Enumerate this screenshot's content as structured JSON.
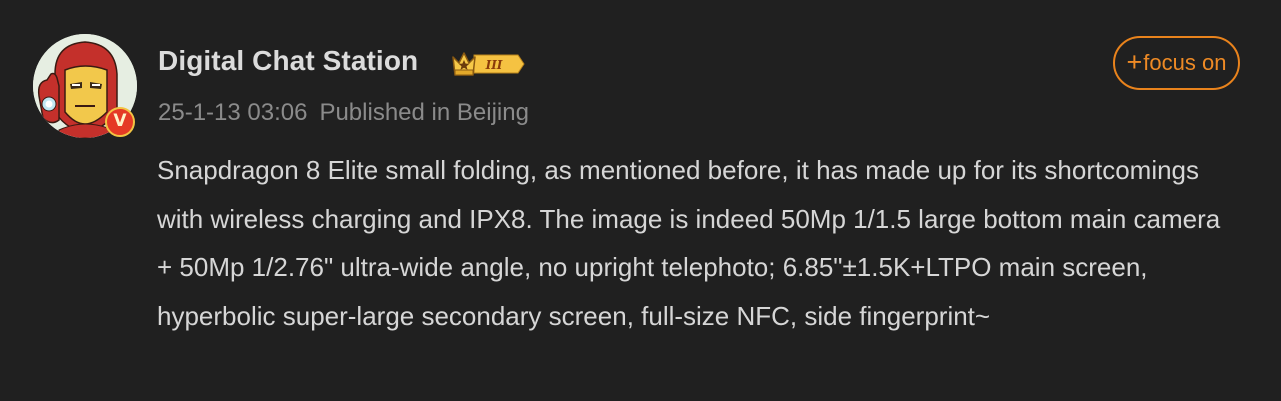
{
  "post": {
    "author_name": "Digital Chat Station",
    "rank_label": "III",
    "verified_label": "V",
    "timestamp": "25-1-13 03:06",
    "location_text": "Published in Beijing",
    "follow_plus": "+",
    "follow_label": "focus on",
    "body": "Snapdragon 8 Elite small folding, as mentioned before, it has made up for its shortcomings with wireless charging and IPX8. The image is indeed 50Mp 1/1.5 large bottom main camera + 50Mp 1/2.76\" ultra-wide angle, no upright telephoto; 6.85\"±1.5K+LTPO main screen, hyperbolic super-large secondary screen, full-size NFC, side fingerprint~"
  },
  "icons": {
    "avatar": "iron-man-cartoon-avatar",
    "verified": "verified-v-badge-icon",
    "rank": "crown-rank-badge-icon"
  },
  "colors": {
    "background": "#202020",
    "accent_orange": "#e9831c",
    "verified_red": "#e53a25",
    "rank_gold": "#f5c242"
  }
}
